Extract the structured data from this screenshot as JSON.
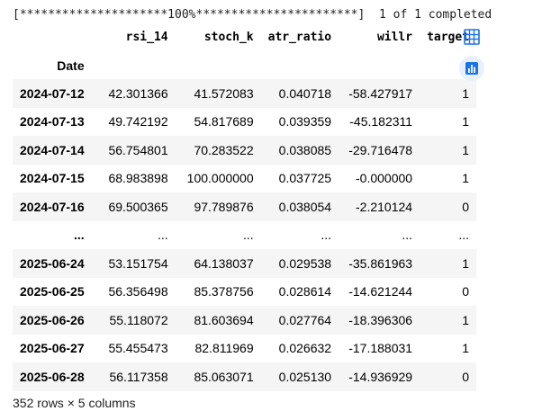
{
  "progress_text": "[*********************100%***********************]  1 of 1 completed",
  "dataframe": {
    "columns": [
      "rsi_14",
      "stoch_k",
      "atr_ratio",
      "willr",
      "target"
    ],
    "index_name": "Date",
    "rows": [
      {
        "date": "2024-07-12",
        "rsi_14": "42.301366",
        "stoch_k": "41.572083",
        "atr_ratio": "0.040718",
        "willr": "-58.427917",
        "target": "1"
      },
      {
        "date": "2024-07-13",
        "rsi_14": "49.742192",
        "stoch_k": "54.817689",
        "atr_ratio": "0.039359",
        "willr": "-45.182311",
        "target": "1"
      },
      {
        "date": "2024-07-14",
        "rsi_14": "56.754801",
        "stoch_k": "70.283522",
        "atr_ratio": "0.038085",
        "willr": "-29.716478",
        "target": "1"
      },
      {
        "date": "2024-07-15",
        "rsi_14": "68.983898",
        "stoch_k": "100.000000",
        "atr_ratio": "0.037725",
        "willr": "-0.000000",
        "target": "1"
      },
      {
        "date": "2024-07-16",
        "rsi_14": "69.500365",
        "stoch_k": "97.789876",
        "atr_ratio": "0.038054",
        "willr": "-2.210124",
        "target": "0"
      },
      {
        "date": "...",
        "rsi_14": "...",
        "stoch_k": "...",
        "atr_ratio": "...",
        "willr": "...",
        "target": "..."
      },
      {
        "date": "2025-06-24",
        "rsi_14": "53.151754",
        "stoch_k": "64.138037",
        "atr_ratio": "0.029538",
        "willr": "-35.861963",
        "target": "1"
      },
      {
        "date": "2025-06-25",
        "rsi_14": "56.356498",
        "stoch_k": "85.378756",
        "atr_ratio": "0.028614",
        "willr": "-14.621244",
        "target": "0"
      },
      {
        "date": "2025-06-26",
        "rsi_14": "55.118072",
        "stoch_k": "81.603694",
        "atr_ratio": "0.027764",
        "willr": "-18.396306",
        "target": "1"
      },
      {
        "date": "2025-06-27",
        "rsi_14": "55.455473",
        "stoch_k": "82.811969",
        "atr_ratio": "0.026632",
        "willr": "-17.188031",
        "target": "1"
      },
      {
        "date": "2025-06-28",
        "rsi_14": "56.117358",
        "stoch_k": "85.063071",
        "atr_ratio": "0.025130",
        "willr": "-14.936929",
        "target": "0"
      }
    ],
    "shape_text": "352 rows × 5 columns"
  },
  "buttons": {
    "table_icon": "table-icon",
    "chart_icon": "bar-chart-icon"
  },
  "colors": {
    "accent": "#1a73e8",
    "button_bg": "#e8f0fe",
    "row_stripe": "#f5f5f5"
  }
}
